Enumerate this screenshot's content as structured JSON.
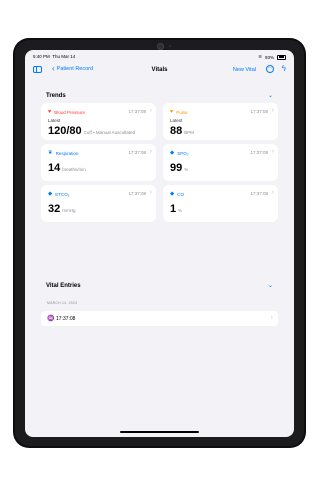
{
  "status": {
    "time": "5:40 PM",
    "date": "Thu Mar 14",
    "battery": "93%"
  },
  "nav": {
    "back_label": "Patient Record",
    "title": "Vitals",
    "new_label": "New Vital"
  },
  "trends": {
    "heading": "Trends",
    "cards": [
      {
        "label": "Blood Pressure",
        "label_color": "#ff3b30",
        "icon": "heart-icon",
        "time": "17:37:08",
        "latest": "Latest",
        "value": "120/80",
        "unit": "Cuff • Manual Auscultated"
      },
      {
        "label": "Pulse",
        "label_color": "#ff9500",
        "icon": "heart-icon",
        "time": "17:37:08",
        "latest": "Latest",
        "value": "88",
        "unit": "BPM"
      },
      {
        "label": "Respiration",
        "label_color": "#007aff",
        "icon": "lungs-icon",
        "time": "17:37:08",
        "value": "14",
        "unit": "breaths/min"
      },
      {
        "label": "SPO₂",
        "label_color": "#007aff",
        "icon": "drop-icon",
        "time": "17:37:08",
        "value": "99",
        "unit": "%"
      },
      {
        "label": "ETCO₂",
        "label_color": "#007aff",
        "icon": "drop-icon",
        "time": "17:37:08",
        "value": "32",
        "unit": "mmHg"
      },
      {
        "label": "CO",
        "label_color": "#007aff",
        "icon": "drop-icon",
        "time": "17:37:08",
        "value": "1",
        "unit": "%"
      }
    ]
  },
  "entries": {
    "heading": "Vital Entries",
    "date": "MARCH 14, 2024",
    "items": [
      {
        "time": "17:37:08",
        "icon": "waveform-icon"
      }
    ]
  }
}
